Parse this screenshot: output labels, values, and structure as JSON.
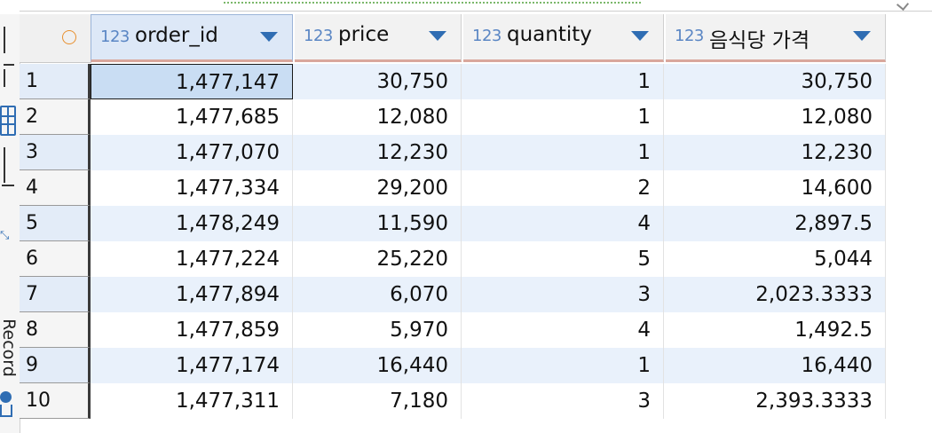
{
  "grid": {
    "columns": [
      {
        "type": "123",
        "name": "order_id"
      },
      {
        "type": "123",
        "name": "price"
      },
      {
        "type": "123",
        "name": "quantity"
      },
      {
        "type": "123",
        "name": "음식당 가격"
      }
    ],
    "rows": [
      {
        "num": "1",
        "cells": [
          "1,477,147",
          "30,750",
          "1",
          "30,750"
        ]
      },
      {
        "num": "2",
        "cells": [
          "1,477,685",
          "12,080",
          "1",
          "12,080"
        ]
      },
      {
        "num": "3",
        "cells": [
          "1,477,070",
          "12,230",
          "1",
          "12,230"
        ]
      },
      {
        "num": "4",
        "cells": [
          "1,477,334",
          "29,200",
          "2",
          "14,600"
        ]
      },
      {
        "num": "5",
        "cells": [
          "1,478,249",
          "11,590",
          "4",
          "2,897.5"
        ]
      },
      {
        "num": "6",
        "cells": [
          "1,477,224",
          "25,220",
          "5",
          "5,044"
        ]
      },
      {
        "num": "7",
        "cells": [
          "1,477,894",
          "6,070",
          "3",
          "2,023.3333"
        ]
      },
      {
        "num": "8",
        "cells": [
          "1,477,859",
          "5,970",
          "4",
          "1,492.5"
        ]
      },
      {
        "num": "9",
        "cells": [
          "1,477,174",
          "16,440",
          "1",
          "16,440"
        ]
      },
      {
        "num": "10",
        "cells": [
          "1,477,311",
          "7,180",
          "3",
          "2,393.3333"
        ]
      }
    ]
  },
  "side_panel": {
    "record_label": "Record",
    "icons": [
      "grid-icon",
      "expand-icon",
      "record-icon"
    ]
  },
  "colors": {
    "accent": "#2f6db3",
    "row_alt": "#e9f1fb",
    "header_underline": "#d9a79c",
    "corner_circle": "#e8902f"
  }
}
